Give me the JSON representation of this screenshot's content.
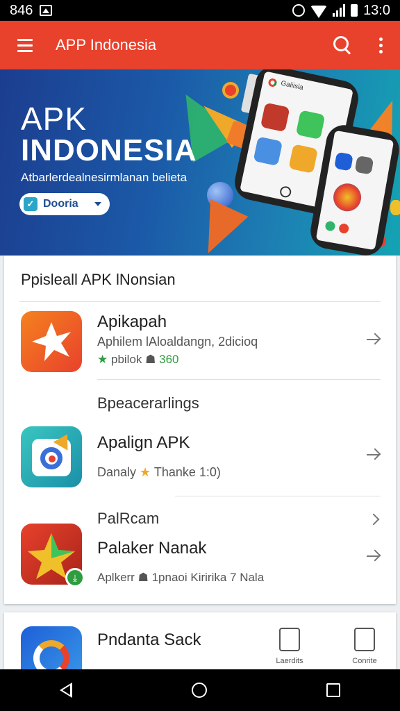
{
  "status_bar": {
    "time_left": "846",
    "time_right": "13:0"
  },
  "app_bar": {
    "title": "APP Indonesia"
  },
  "banner": {
    "title_line1": "APK",
    "title_line2": "INDONESIA",
    "subtitle": "Atbarlerdealnesirmlanan belieta",
    "dropdown_label": "Dooria",
    "phone_header": "Gaiiisia"
  },
  "section": {
    "title": "Ppisleall APK lNonsian",
    "items": [
      {
        "name": "Apikapah",
        "desc": "Aphilem lAloaldangn, 2dicioq",
        "meta_label": "pbilok",
        "meta_value": "360"
      },
      {
        "name": "Apalign APK",
        "desc": "Danaly",
        "meta_value": "Thanke 1:0)"
      },
      {
        "name": "Palaker Nanak",
        "desc": "Aplkerr",
        "meta_value": "1pnaoi Kiririka 7 Nala"
      }
    ],
    "sub_heading_1": "Bpeacerarlings",
    "sub_heading_2": "PalRcam"
  },
  "bottom_card": {
    "item_name": "Pndanta Sack",
    "tools": [
      {
        "label": "Laerdits",
        "icon": "document-icon"
      },
      {
        "label": "Conrite",
        "icon": "clipboard-icon"
      }
    ]
  },
  "colors": {
    "app_bar": "#e8412c",
    "accent_green": "#2e9c3f",
    "banner_blue": "#1b5aa8"
  }
}
